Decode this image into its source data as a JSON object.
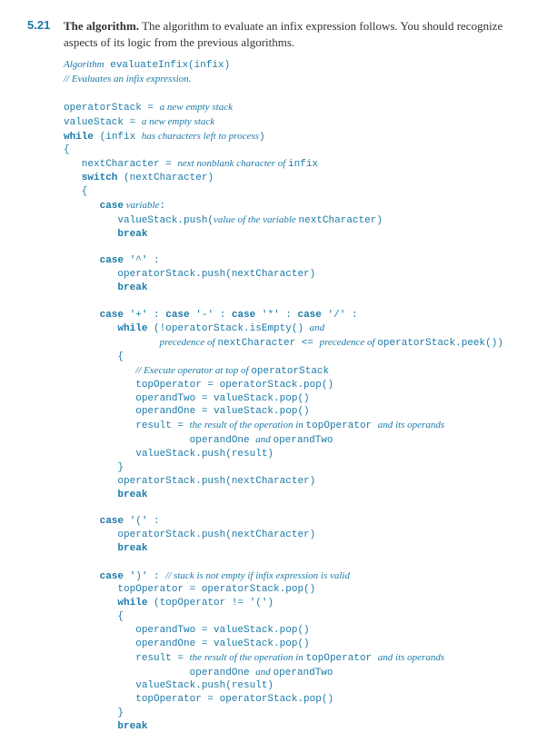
{
  "section": {
    "number": "5.21",
    "title": "The algorithm.",
    "intro": "The algorithm to evaluate an infix expression follows. You should recognize aspects of its logic from the previous algorithms."
  },
  "algo": {
    "l1a": "Algorithm",
    "l1b": "evaluateInfix(infix)",
    "l2": "// Evaluates an infix expression.",
    "l3a": "operatorStack = ",
    "l3b": "a new empty stack",
    "l4a": "valueStack = ",
    "l4b": "a new empty stack",
    "l5a": "while",
    "l5b": " (infix ",
    "l5c": "has characters left to process",
    "l5d": ")",
    "l6": "{",
    "l7a": "   nextCharacter = ",
    "l7b": "next nonblank character of ",
    "l7c": "infix",
    "l8a": "   switch",
    "l8b": " (nextCharacter)",
    "l9": "   {",
    "l10a": "      case",
    "l10b": " variable",
    "l10c": ":",
    "l11a": "         valueStack.push(",
    "l11b": "value of the variable ",
    "l11c": "nextCharacter)",
    "l12": "         break",
    "l13a": "      case",
    "l13b": " '^' :",
    "l14": "         operatorStack.push(nextCharacter)",
    "l15": "         break",
    "l16a": "      case",
    "l16b": " '+' : ",
    "l16c": "case",
    "l16d": " '-' : ",
    "l16e": "case",
    "l16f": " '*' : ",
    "l16g": "case",
    "l16h": " '/' :",
    "l17a": "         while",
    "l17b": " (!operatorStack.isEmpty() ",
    "l17c": "and",
    "l18a": "                ",
    "l18b": "precedence of ",
    "l18c": "nextCharacter <= ",
    "l18d": "precedence of ",
    "l18e": "operatorStack.peek())",
    "l19": "         {",
    "l20a": "            ",
    "l20b": "// Execute operator at top of ",
    "l20c": "operatorStack",
    "l21": "            topOperator = operatorStack.pop()",
    "l22": "            operandTwo = valueStack.pop()",
    "l23": "            operandOne = valueStack.pop()",
    "l24a": "            result = ",
    "l24b": "the result of the operation in ",
    "l24c": "topOperator ",
    "l24d": "and its operands",
    "l25a": "                     operandOne ",
    "l25b": "and ",
    "l25c": "operandTwo",
    "l26": "            valueStack.push(result)",
    "l27": "         }",
    "l28": "         operatorStack.push(nextCharacter)",
    "l29": "         break",
    "l30a": "      case",
    "l30b": " '(' :",
    "l31": "         operatorStack.push(nextCharacter)",
    "l32": "         break",
    "l33a": "      case",
    "l33b": " ')' : ",
    "l33c": "// stack is not empty if infix expression is valid",
    "l34": "         topOperator = operatorStack.pop()",
    "l35a": "         while",
    "l35b": " (topOperator != '(')",
    "l36": "         {",
    "l37": "            operandTwo = valueStack.pop()",
    "l38": "            operandOne = valueStack.pop()",
    "l39a": "            result = ",
    "l39b": "the result of the operation in ",
    "l39c": "topOperator ",
    "l39d": "and its operands",
    "l40a": "                     operandOne ",
    "l40b": "and ",
    "l40c": "operandTwo",
    "l41": "            valueStack.push(result)",
    "l42": "            topOperator = operatorStack.pop()",
    "l43": "         }",
    "l44": "         break"
  }
}
